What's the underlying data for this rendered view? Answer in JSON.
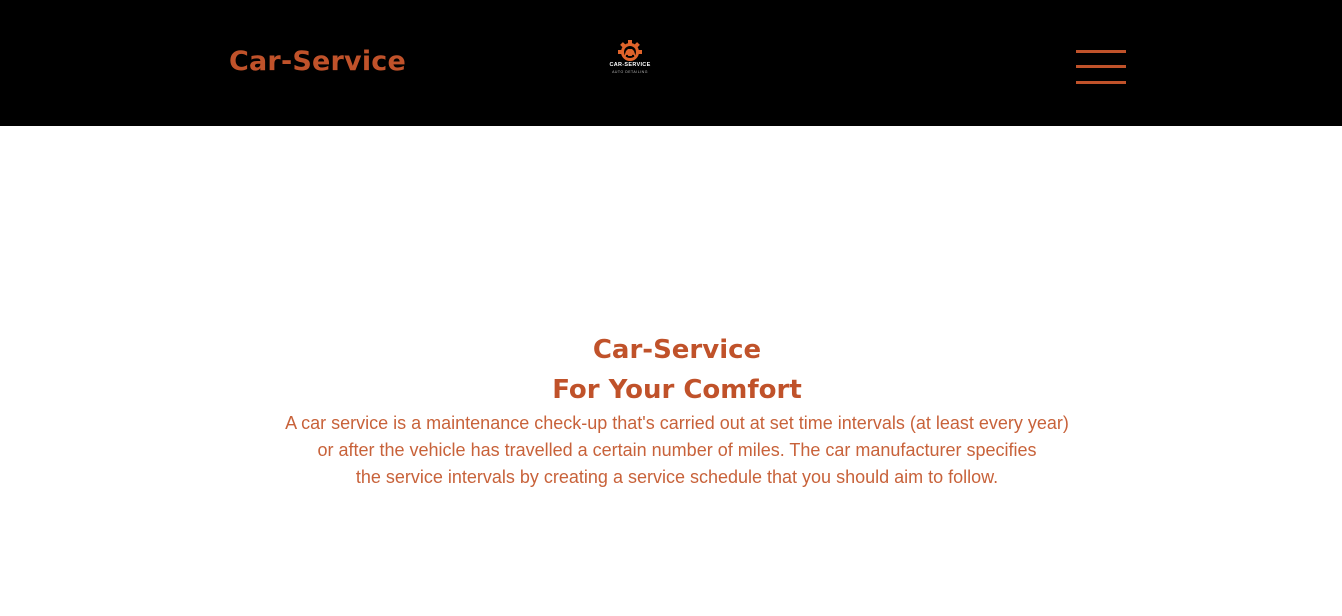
{
  "header": {
    "brand": "Car-Service",
    "logo": {
      "icon": "gear-car-icon",
      "title": "CAR-SERVICE",
      "subtitle": "AUTO DETAILING"
    },
    "menu_icon": "hamburger-menu-icon"
  },
  "hero": {
    "title_line1": "Car-Service",
    "title_line2": "For Your Comfort",
    "text_line1": "A car service is a maintenance check-up that's carried out at set time intervals (at least every year)",
    "text_line2": "or after the vehicle has travelled a certain number of miles. The car manufacturer specifies",
    "text_line3": "the service intervals by creating a service schedule that you should aim to follow."
  },
  "colors": {
    "accent": "#c0522a",
    "header_bg": "#000000",
    "page_bg": "#ffffff"
  }
}
